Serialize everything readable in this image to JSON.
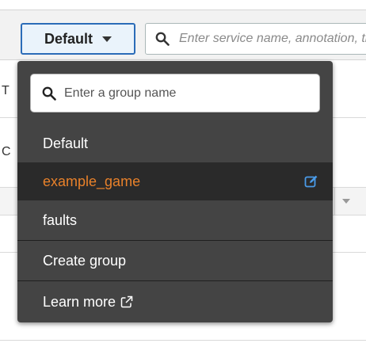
{
  "toolbar": {
    "group_select": {
      "label": "Default"
    },
    "search": {
      "placeholder": "Enter service name, annotation, trace ID."
    }
  },
  "background": {
    "peek_a": "T",
    "peek_b": "C"
  },
  "dropdown": {
    "search": {
      "placeholder": "Enter a group name"
    },
    "groups": [
      {
        "label": "Default"
      },
      {
        "label": "example_game"
      },
      {
        "label": "faults"
      }
    ],
    "create_label": "Create group",
    "learn_more_label": "Learn more"
  },
  "colors": {
    "accent": "#e8812a",
    "focus_border": "#2b6cb8",
    "menu_bg": "#444444",
    "menu_selected_bg": "#2a2a2a",
    "edit_icon": "#4a9be8"
  }
}
